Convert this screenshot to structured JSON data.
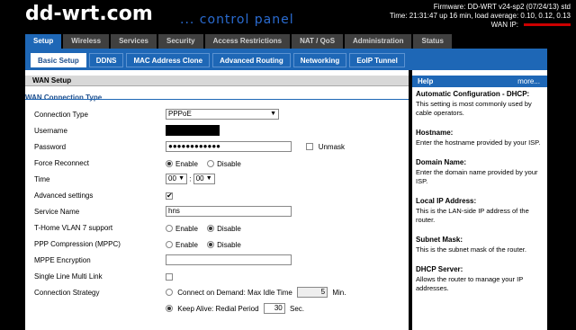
{
  "header": {
    "logo_main": "dd-wrt.com",
    "logo_sub": "... control panel",
    "firmware": "Firmware: DD-WRT v24-sp2 (07/24/13) std",
    "time": "Time: 21:31:47 up 16 min, load average: 0.10, 0.12, 0.13",
    "wan_ip_label": "WAN IP:"
  },
  "tabs": [
    "Setup",
    "Wireless",
    "Services",
    "Security",
    "Access Restrictions",
    "NAT / QoS",
    "Administration",
    "Status"
  ],
  "subtabs": [
    "Basic Setup",
    "DDNS",
    "MAC Address Clone",
    "Advanced Routing",
    "Networking",
    "EoIP Tunnel"
  ],
  "section": {
    "title": "WAN Setup",
    "legend": "WAN Connection Type"
  },
  "form": {
    "connection_type": {
      "label": "Connection Type",
      "value": "PPPoE"
    },
    "username": {
      "label": "Username"
    },
    "password": {
      "label": "Password",
      "value": "●●●●●●●●●●●●",
      "unmask_label": "Unmask"
    },
    "force_reconnect": {
      "label": "Force Reconnect",
      "enable": "Enable",
      "disable": "Disable"
    },
    "time": {
      "label": "Time",
      "hour": "00",
      "minute": "00",
      "sep": ":"
    },
    "advanced": {
      "label": "Advanced settings",
      "check": "✔"
    },
    "service_name": {
      "label": "Service Name",
      "value": "hns"
    },
    "vlan7": {
      "label": "T-Home VLAN 7 support",
      "enable": "Enable",
      "disable": "Disable"
    },
    "mppc": {
      "label": "PPP Compression (MPPC)",
      "enable": "Enable",
      "disable": "Disable"
    },
    "mppe": {
      "label": "MPPE Encryption"
    },
    "multilink": {
      "label": "Single Line Multi Link"
    },
    "strategy": {
      "label": "Connection Strategy",
      "demand_label": "Connect on Demand: Max Idle Time",
      "demand_value": "5",
      "demand_unit": "Min.",
      "keepalive_label": "Keep Alive: Redial Period",
      "keepalive_value": "30",
      "keepalive_unit": "Sec."
    }
  },
  "help": {
    "title": "Help",
    "more": "more...",
    "items": [
      {
        "title": "Automatic Configuration - DHCP:",
        "text": "This setting is most commonly used by cable operators."
      },
      {
        "title": "Hostname:",
        "text": "Enter the hostname provided by your ISP."
      },
      {
        "title": "Domain Name:",
        "text": "Enter the domain name provided by your ISP."
      },
      {
        "title": "Local IP Address:",
        "text": "This is the LAN-side IP address of the router."
      },
      {
        "title": "Subnet Mask:",
        "text": "This is the subnet mask of the router."
      },
      {
        "title": "DHCP Server:",
        "text": "Allows the router to manage your IP addresses."
      }
    ]
  },
  "colors": {
    "accent": "#1e67b6",
    "tab_inactive": "#404040",
    "wan_ip_redaction": "#cc0000"
  }
}
